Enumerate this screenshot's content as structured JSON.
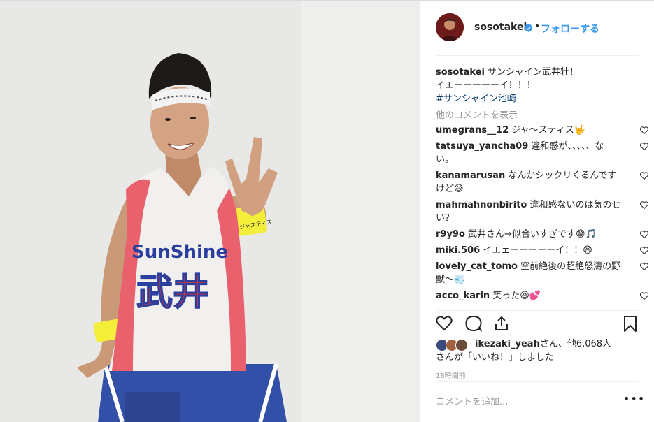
{
  "post": {
    "username": "sosotakei",
    "follow_label": "フォローする",
    "dot": "•",
    "caption_text": " サンシャイン武井壮！",
    "caption_line2": "イエーーーーーイ！！！",
    "hashtag": "#サンシャイン池崎",
    "view_more_comments": "他のコメントを表示",
    "likes_user": "ikezaki_yeah",
    "likes_mid": "さん、他6,068人",
    "likes_end": "さんが「いいね！」しました",
    "timestamp": "18時間前",
    "add_comment_placeholder": "コメントを追加...",
    "more_label": "•••"
  },
  "comments": [
    {
      "user": "umegrans__12",
      "text": " ジャ〜スティス🤟"
    },
    {
      "user": "tatsuya_yancha09",
      "text": " 違和感が、、、、、ない。"
    },
    {
      "user": "kanamarusan",
      "text": " なんかシックリくるんですけど😅"
    },
    {
      "user": "mahmahnonbirito",
      "text": " 違和感ないのは気のせい？"
    },
    {
      "user": "r9y9o",
      "text": " 武井さん→似合いすぎです😁🎵"
    },
    {
      "user": "miki.506",
      "text": " イエェーーーーーイ！！😆"
    },
    {
      "user": "lovely_cat_tomo",
      "text": " 空前絶後の超絶怒濤の野獣〜💨"
    },
    {
      "user": "acco_karin",
      "text": " 笑った😆💕"
    }
  ],
  "photo": {
    "jersey_text": "SunShine",
    "jersey_kanji": "武井",
    "wristband_text": "ジャスティス"
  },
  "colors": {
    "link_blue": "#3897f0",
    "hashtag_blue": "#003569",
    "muted_gray": "#999999",
    "text": "#262626",
    "verified": "#3897f0"
  }
}
